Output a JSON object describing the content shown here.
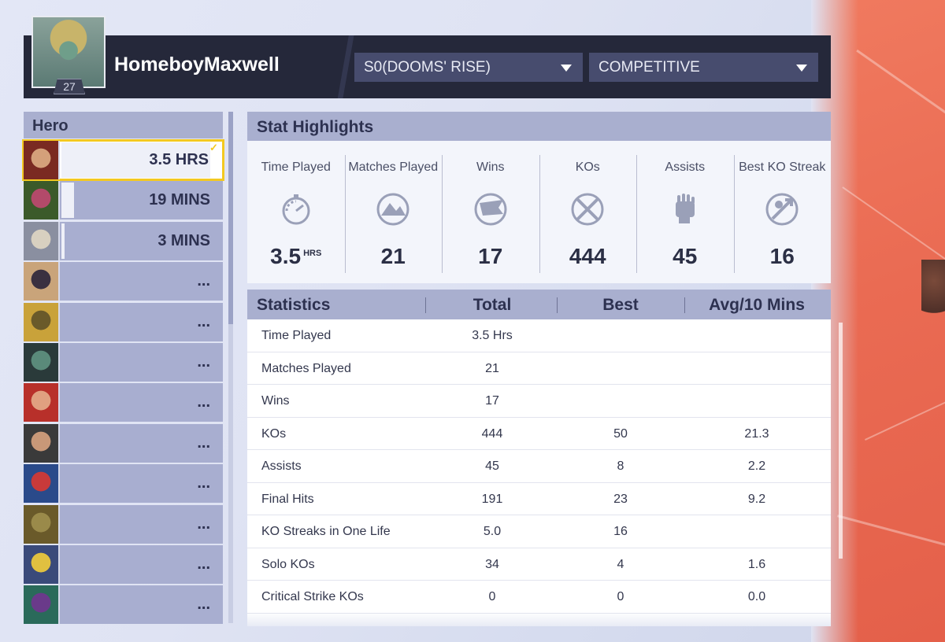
{
  "player": {
    "name": "HomeboyMaxwell",
    "level": "27"
  },
  "filters": {
    "season": "S0(DOOMS' RISE)",
    "mode": "COMPETITIVE"
  },
  "hero_panel": {
    "title": "Hero",
    "heroes": [
      {
        "time": "3.5 HRS",
        "fill": 0.92,
        "colors": [
          "#7a2a22",
          "#d4a07a"
        ]
      },
      {
        "time": "19 MINS",
        "fill": 0.08,
        "colors": [
          "#3b5a2a",
          "#b34a6a"
        ]
      },
      {
        "time": "3 MINS",
        "fill": 0.02,
        "colors": [
          "#8a8fa0",
          "#d8d0c0"
        ]
      },
      {
        "time": "...",
        "fill": 0,
        "colors": [
          "#c9a47a",
          "#3a3040"
        ]
      },
      {
        "time": "...",
        "fill": 0,
        "colors": [
          "#c9a23a",
          "#6a5a2a"
        ]
      },
      {
        "time": "...",
        "fill": 0,
        "colors": [
          "#2a3a3a",
          "#5a8a7a"
        ]
      },
      {
        "time": "...",
        "fill": 0,
        "colors": [
          "#b8302a",
          "#e0a080"
        ]
      },
      {
        "time": "...",
        "fill": 0,
        "colors": [
          "#3a3a3a",
          "#c89878"
        ]
      },
      {
        "time": "...",
        "fill": 0,
        "colors": [
          "#2a4a8a",
          "#c83a3a"
        ]
      },
      {
        "time": "...",
        "fill": 0,
        "colors": [
          "#6a5a2a",
          "#9a8a4a"
        ]
      },
      {
        "time": "...",
        "fill": 0,
        "colors": [
          "#3a4a7a",
          "#e0c040"
        ]
      },
      {
        "time": "...",
        "fill": 0,
        "colors": [
          "#2a6a5a",
          "#6a3a8a"
        ]
      }
    ]
  },
  "highlights": {
    "title": "Stat Highlights",
    "items": [
      {
        "label": "Time Played",
        "value": "3.5",
        "unit": "HRS",
        "icon": "stopwatch-icon"
      },
      {
        "label": "Matches Played",
        "value": "21",
        "unit": "",
        "icon": "matches-icon"
      },
      {
        "label": "Wins",
        "value": "17",
        "unit": "",
        "icon": "flag-icon"
      },
      {
        "label": "KOs",
        "value": "444",
        "unit": "",
        "icon": "crossed-swords-icon"
      },
      {
        "label": "Assists",
        "value": "45",
        "unit": "",
        "icon": "fist-icon"
      },
      {
        "label": "Best KO Streak",
        "value": "16",
        "unit": "",
        "icon": "streak-icon"
      }
    ]
  },
  "statistics": {
    "headers": {
      "name": "Statistics",
      "total": "Total",
      "best": "Best",
      "avg": "Avg/10 Mins"
    },
    "rows": [
      {
        "name": "Time Played",
        "total": "3.5 Hrs",
        "best": "",
        "avg": ""
      },
      {
        "name": "Matches Played",
        "total": "21",
        "best": "",
        "avg": ""
      },
      {
        "name": "Wins",
        "total": "17",
        "best": "",
        "avg": ""
      },
      {
        "name": "KOs",
        "total": "444",
        "best": "50",
        "avg": "21.3"
      },
      {
        "name": "Assists",
        "total": "45",
        "best": "8",
        "avg": "2.2"
      },
      {
        "name": "Final Hits",
        "total": "191",
        "best": "23",
        "avg": "9.2"
      },
      {
        "name": "KO Streaks in One Life",
        "total": "5.0",
        "best": "16",
        "avg": ""
      },
      {
        "name": "Solo KOs",
        "total": "34",
        "best": "4",
        "avg": "1.6"
      },
      {
        "name": "Critical Strike KOs",
        "total": "0",
        "best": "0",
        "avg": "0.0"
      }
    ]
  }
}
